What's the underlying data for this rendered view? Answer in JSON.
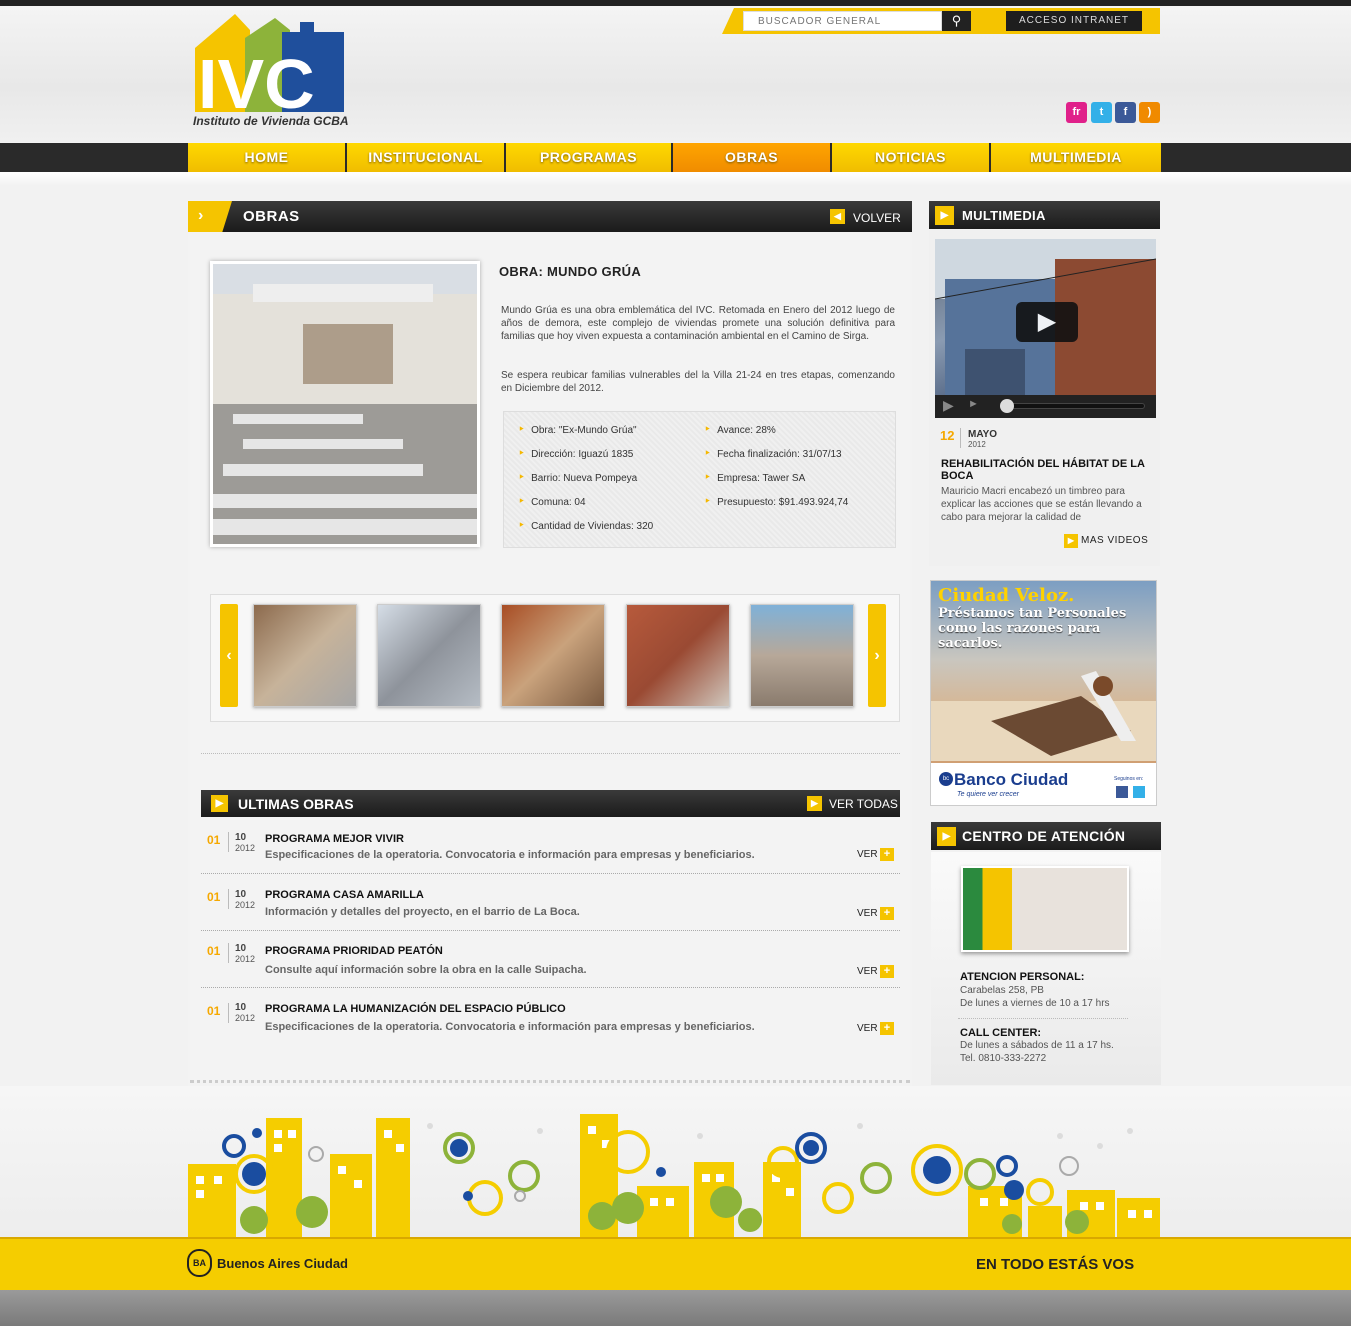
{
  "header": {
    "logo_text": "IVC",
    "logo_subtitle": "Instituto de Vivienda GCBA",
    "search_placeholder": "BUSCADOR GENERAL",
    "intranet_label": "ACCESO INTRANET",
    "social": [
      "flickr-icon",
      "twitter-icon",
      "facebook-icon",
      "rss-icon"
    ],
    "social_labels": {
      "flickr": "fr",
      "twitter": "t",
      "facebook": "f",
      "rss": ")"
    }
  },
  "nav": {
    "items": [
      "HOME",
      "INSTITUCIONAL",
      "PROGRAMAS",
      "OBRAS",
      "NOTICIAS",
      "MULTIMEDIA"
    ],
    "active": "OBRAS"
  },
  "obras": {
    "section_title": "OBRAS",
    "back_label": "VOLVER",
    "title": "OBRA: MUNDO GRÚA",
    "paragraph1": "Mundo Grúa es una obra emblemática del IVC. Retomada en Enero del 2012 luego de años de demora, este complejo de viviendas promete una solución definitiva para familias que hoy viven expuesta a contaminación ambiental en el Camino de Sirga.",
    "paragraph2": "Se espera reubicar familias vulnerables del la Villa 21-24 en tres etapas, comenzando en Diciembre del 2012.",
    "details_left": [
      "Obra:  \"Ex-Mundo Grúa\"",
      "Dirección: Iguazú 1835",
      "Barrio:  Nueva Pompeya",
      "Comuna: 04",
      "Cantidad de Viviendas:  320"
    ],
    "details_right": [
      "Avance: 28%",
      "Fecha finalización: 31/07/13",
      "Empresa: Tawer SA",
      "Presupuesto:  $91.493.924,74"
    ]
  },
  "ultimas": {
    "title": "ULTIMAS OBRAS",
    "ver_todas": "VER TODAS",
    "ver_label": "VER",
    "items": [
      {
        "day": "01",
        "month": "10",
        "year": "2012",
        "title": "PROGRAMA MEJOR VIVIR",
        "desc": "Especificaciones de la operatoria. Convocatoria e información para empresas y beneficiarios."
      },
      {
        "day": "01",
        "month": "10",
        "year": "2012",
        "title": "PROGRAMA CASA AMARILLA",
        "desc": "Información y detalles del proyecto, en el barrio de La Boca."
      },
      {
        "day": "01",
        "month": "10",
        "year": "2012",
        "title": "PROGRAMA PRIORIDAD PEATÓN",
        "desc": "Consulte aquí información sobre la obra en la calle Suipacha."
      },
      {
        "day": "01",
        "month": "10",
        "year": "2012",
        "title": "PROGRAMA LA HUMANIZACIÓN DEL ESPACIO PÚBLICO",
        "desc": "Especificaciones de la operatoria. Convocatoria e información para empresas y beneficiarios."
      }
    ]
  },
  "multimedia": {
    "title": "MULTIMEDIA",
    "day": "12",
    "month": "MAYO",
    "year": "2012",
    "headline": "REHABILITACIÓN DEL HÁBITAT DE LA BOCA",
    "desc": "Mauricio Macri encabezó un timbreo para explicar las acciones que se están llevando a cabo para mejorar la calidad de",
    "more": "MAS VIDEOS"
  },
  "ad": {
    "title": "Ciudad Veloz.",
    "subtitle": "Préstamos tan Personales como las razones para sacarlos.",
    "bank": "Banco Ciudad",
    "bank_sub": "Te quiere ver crecer",
    "follow": "Seguinos en:"
  },
  "atencion": {
    "title": "CENTRO DE ATENCIÓN",
    "personal_title": "ATENCION PERSONAL:",
    "personal_addr": "Carabelas 258, PB",
    "personal_hours": "De lunes a viernes de 10 a 17 hrs",
    "call_title": "CALL CENTER:",
    "call_hours": "De lunes a sábados de 11 a 17 hs.",
    "call_tel": "Tel. 0810-333-2272"
  },
  "footer": {
    "ba_text": "Buenos Aires Ciudad",
    "slogan": "EN TODO ESTÁS VOS"
  },
  "colors": {
    "accent": "#f5c400",
    "active_nav": "#f5a000",
    "dark_bar": "#222222"
  }
}
